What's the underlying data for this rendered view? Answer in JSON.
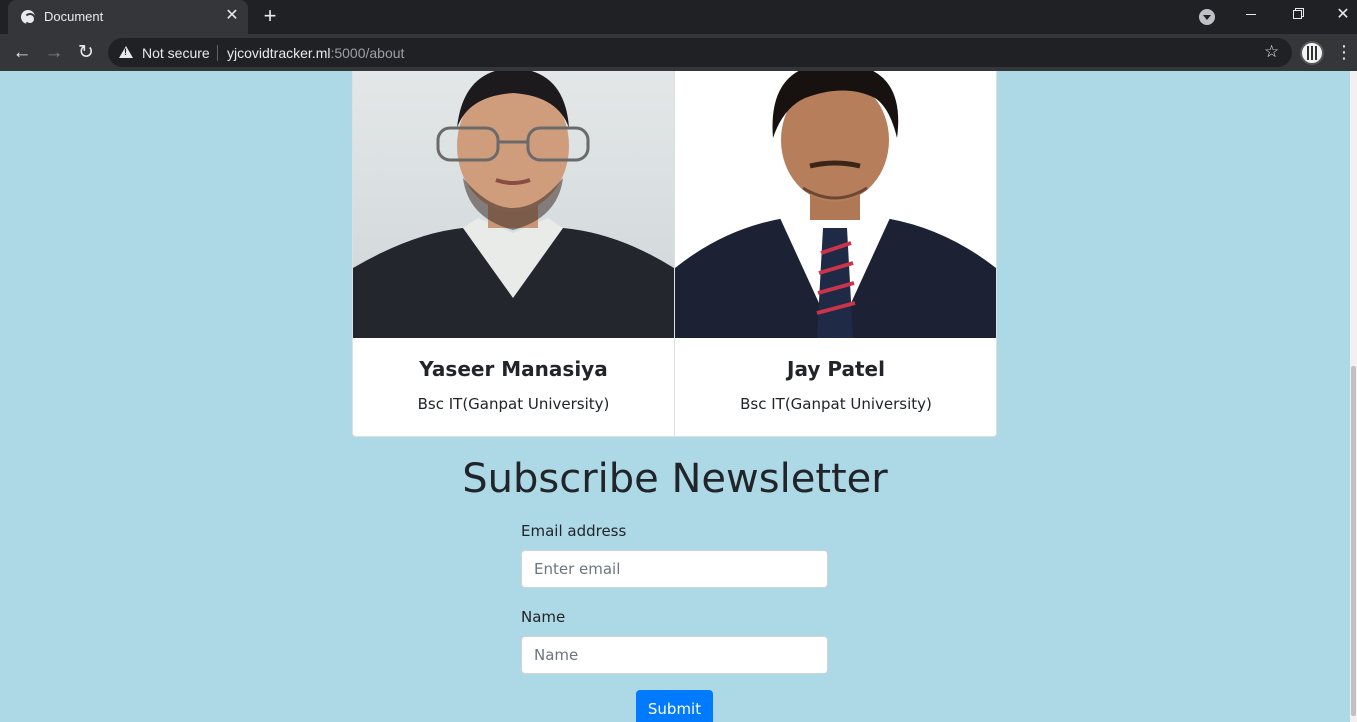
{
  "browser": {
    "tab_title": "Document",
    "security_label": "Not secure",
    "url_host": "yjcovidtracker.ml",
    "url_rest": ":5000/about"
  },
  "team": [
    {
      "name": "Yaseer Manasiya",
      "role": "Bsc IT(Ganpat University)"
    },
    {
      "name": "Jay Patel",
      "role": "Bsc IT(Ganpat University)"
    }
  ],
  "newsletter": {
    "heading": "Subscribe Newsletter",
    "email_label": "Email address",
    "email_placeholder": "Enter email",
    "name_label": "Name",
    "name_placeholder": "Name",
    "submit_label": "Submit"
  },
  "colors": {
    "page_background": "#add8e6",
    "primary_button": "#007bff"
  }
}
